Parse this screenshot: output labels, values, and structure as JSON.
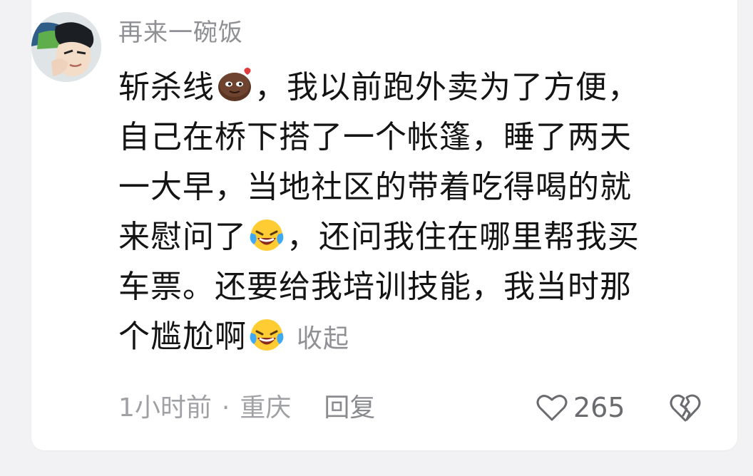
{
  "comment": {
    "username": "再来一碗饭",
    "lines": [
      {
        "before": "斩杀线",
        "emoji": "brown-face-emoji",
        "after": "，我以前跑外卖为了方便，"
      },
      {
        "text": "自己在桥下搭了一个帐篷，睡了两天"
      },
      {
        "text": "一大早，当地社区的带着吃得喝的就"
      },
      {
        "before": "来慰问了",
        "emoji": "laughing-crying-emoji",
        "after": "，还问我住在哪里帮我买"
      },
      {
        "text": "车票。还要给我培训技能，我当时那"
      },
      {
        "before": "个尴尬啊",
        "emoji": "laughing-crying-emoji"
      }
    ],
    "collapse_label": "收起",
    "time": "1小时前",
    "separator": "·",
    "location": "重庆",
    "reply_label": "回复",
    "like_count": "265",
    "icons": {
      "like": "heart-outline-icon",
      "dislike": "broken-heart-icon"
    }
  }
}
